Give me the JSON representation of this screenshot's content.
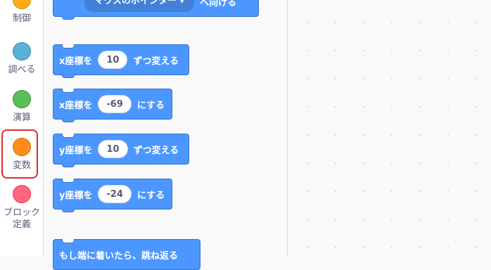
{
  "categories": {
    "control": {
      "label": "制御",
      "color": "#ffab19"
    },
    "sensing": {
      "label": "調べる",
      "color": "#5cb1d6"
    },
    "operators": {
      "label": "演算",
      "color": "#59c059"
    },
    "variables": {
      "label": "変数",
      "color": "#ff8c1a"
    },
    "my_blocks": {
      "label": "ブロック定義",
      "color": "#ff6680"
    }
  },
  "blocks": {
    "point_towards": {
      "dropdown": "マウスのポインター ▾",
      "suffix": "へ向ける"
    },
    "change_x": {
      "prefix": "x座標を",
      "value": "10",
      "suffix": "ずつ変える"
    },
    "set_x": {
      "prefix": "x座標を",
      "value": "-69",
      "suffix": "にする"
    },
    "change_y": {
      "prefix": "y座標を",
      "value": "10",
      "suffix": "ずつ変える"
    },
    "set_y": {
      "prefix": "y座標を",
      "value": "-24",
      "suffix": "にする"
    },
    "bounce": {
      "label": "もし端に着いたら、跳ね返る"
    }
  },
  "colors": {
    "motion": "#4c97ff",
    "highlight": "#e02b2b"
  }
}
